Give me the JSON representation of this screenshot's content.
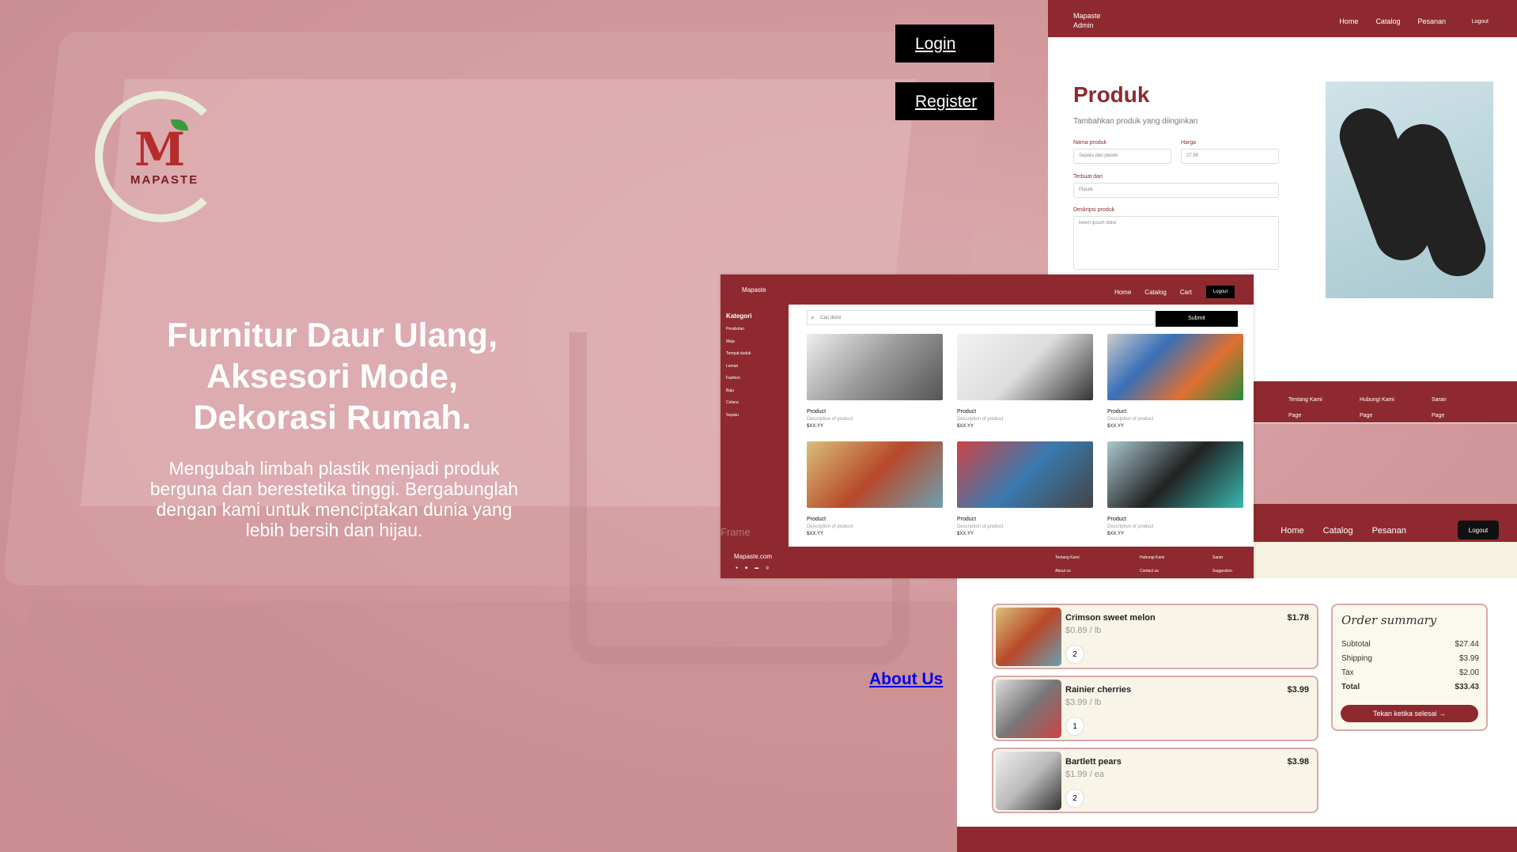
{
  "hero": {
    "title_lines": [
      "Furnitur Daur Ulang,",
      "Aksesori Mode,",
      "Dekorasi Rumah."
    ],
    "description": "Mengubah limbah plastik menjadi produk berguna dan berestetika tinggi. Bergabunglah dengan kami untuk menciptakan dunia yang lebih bersih dan hijau."
  },
  "logo": {
    "brand": "MAPASTE",
    "letter": "M"
  },
  "auth": {
    "login": "Login",
    "register": "Register"
  },
  "about_link": "About Us",
  "frame_label": "Frame",
  "admin_panel": {
    "brand_line1": "Mapaste",
    "brand_line2": "Admin",
    "nav": [
      "Home",
      "Catalog",
      "Pesanan"
    ],
    "logout": "Logout",
    "title": "Produk",
    "subtitle": "Tambahkan produk yang diinginkan",
    "fields": {
      "name_label": "Nama produk",
      "name_value": "Sepatu dari plastik",
      "price_label": "Harga",
      "price_value": "27.99",
      "material_label": "Terbuat dari",
      "material_value": "Plastik",
      "desc_label": "Deskripsi produk",
      "desc_value": "lorem ipsum dolor"
    },
    "footer_links": [
      "Tentang Kami",
      "Hubungi Kami",
      "Saran"
    ],
    "footer_sub": [
      "Page",
      "Page",
      "Page"
    ]
  },
  "catalog_panel": {
    "brand": "Mapaste",
    "nav": [
      "Home",
      "Catalog",
      "Cart"
    ],
    "logout": "Logout",
    "sidebar_title": "Kategori",
    "categories": [
      "Perabotan",
      "Meja",
      "Tempat duduk",
      "Lemari",
      "Fashion",
      "Baju",
      "Celana",
      "Sepatu"
    ],
    "search_placeholder": "Cari disini",
    "submit": "Submit",
    "products": [
      {
        "name": "Product",
        "desc": "Description of product",
        "price": "$XX.YY"
      },
      {
        "name": "Product",
        "desc": "Description of product",
        "price": "$XX.YY"
      },
      {
        "name": "Product",
        "desc": "Description of product",
        "price": "$XX.YY"
      },
      {
        "name": "Product",
        "desc": "Description of product",
        "price": "$XX.YY"
      },
      {
        "name": "Product",
        "desc": "Description of product",
        "price": "$XX.YY"
      },
      {
        "name": "Product",
        "desc": "Description of product",
        "price": "$XX.YY"
      }
    ],
    "footer_brand": "Mapaste.com",
    "footer_links": [
      "Tentang Kami",
      "Hubungi Kami",
      "Saran"
    ],
    "footer_sub": [
      "About us",
      "Contact us",
      "Suggestion"
    ]
  },
  "order_panel": {
    "nav": [
      "Home",
      "Catalog",
      "Pesanan"
    ],
    "logout": "Logout",
    "items": [
      {
        "name": "Crimson sweet melon",
        "unit": "$0.89 / lb",
        "price": "$1.78",
        "qty": "2"
      },
      {
        "name": "Rainier cherries",
        "unit": "$3.99 / lb",
        "price": "$3.99",
        "qty": "1"
      },
      {
        "name": "Bartlett pears",
        "unit": "$1.99 / ea",
        "price": "$3.98",
        "qty": "2"
      }
    ],
    "summary": {
      "title": "Order summary",
      "subtotal_label": "Subtotal",
      "subtotal": "$27.44",
      "shipping_label": "Shipping",
      "shipping": "$3.99",
      "tax_label": "Tax",
      "tax": "$2.00",
      "total_label": "Total",
      "total": "$33.43",
      "cta": "Tekan ketika selesai"
    }
  },
  "colors": {
    "brand_red": "#8e2a2f",
    "logo_red": "#b52c2c",
    "leaf_green": "#3b9a3b"
  }
}
